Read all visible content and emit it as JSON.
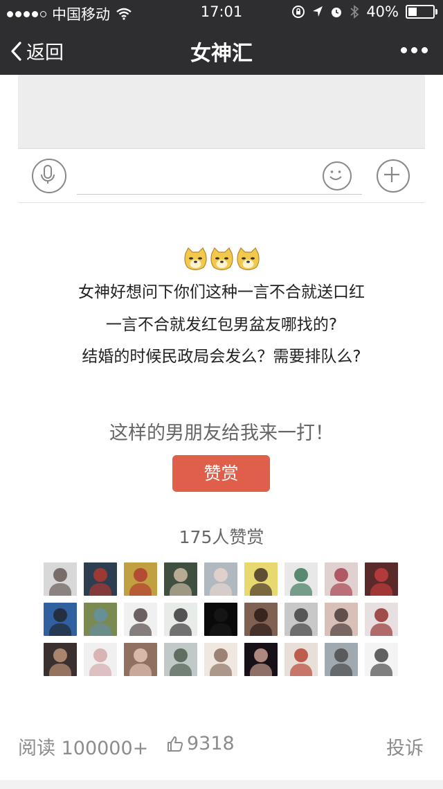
{
  "status_bar": {
    "carrier": "中国移动",
    "time": "17:01",
    "battery": "40%",
    "battery_level": 0.4
  },
  "nav": {
    "back_label": "返回",
    "title": "女神汇"
  },
  "comment_bar": {
    "icons": [
      "microphone-icon",
      "smile-icon",
      "plus-icon"
    ]
  },
  "article": {
    "emoji": [
      "doge",
      "doge",
      "doge"
    ],
    "lines": [
      "女神好想问下你们这种一言不合就送口红",
      "一言不合就发红包男盆友哪找的?",
      "结婚的时候民政局会发么？需要排队么?"
    ]
  },
  "reward": {
    "prompt": "这样的男朋友给我来一打！",
    "button_label": "赞赏",
    "count_text": "175人赞赏",
    "accent": "#e05f4a"
  },
  "avatars": [
    {
      "bg": "#d8d8d8",
      "fg": "#5a4a44"
    },
    {
      "bg": "#2c3e50",
      "fg": "#c0392b"
    },
    {
      "bg": "#c0a040",
      "fg": "#b03030"
    },
    {
      "bg": "#405040",
      "fg": "#e0c8b0"
    },
    {
      "bg": "#b0b8c0",
      "fg": "#f0d8d0"
    },
    {
      "bg": "#e8d870",
      "fg": "#302020"
    },
    {
      "bg": "#e8e8e8",
      "fg": "#2a6a4a"
    },
    {
      "bg": "#e0d0d0",
      "fg": "#a03040"
    },
    {
      "bg": "#5a2a2a",
      "fg": "#d04040"
    },
    {
      "bg": "#3060a0",
      "fg": "#202020"
    },
    {
      "bg": "#7a8a50",
      "fg": "#6090b0"
    },
    {
      "bg": "#f0f0f0",
      "fg": "#403030"
    },
    {
      "bg": "#e8ece8",
      "fg": "#202020"
    },
    {
      "bg": "#0a0a0a",
      "fg": "#1a1a1a"
    },
    {
      "bg": "#806050",
      "fg": "#201010"
    },
    {
      "bg": "#c8c8c8",
      "fg": "#303030"
    },
    {
      "bg": "#d8c0b8",
      "fg": "#3a2a2a"
    },
    {
      "bg": "#e8e0e0",
      "fg": "#8a1a1a"
    },
    {
      "bg": "#3a3030",
      "fg": "#d0a080"
    },
    {
      "bg": "#f0f0f0",
      "fg": "#d0a0a0"
    },
    {
      "bg": "#907060",
      "fg": "#f0d0c0"
    },
    {
      "bg": "#c0c8c8",
      "fg": "#405040"
    },
    {
      "bg": "#f0e8e0",
      "fg": "#806050"
    },
    {
      "bg": "#181018",
      "fg": "#e0b0a0"
    },
    {
      "bg": "#e8e0d8",
      "fg": "#b03020"
    },
    {
      "bg": "#a0a8b0",
      "fg": "#404040"
    },
    {
      "bg": "#f4f4f4",
      "fg": "#303030"
    }
  ],
  "footer": {
    "reads": "阅读 100000+",
    "likes": "9318",
    "report": "投诉"
  }
}
